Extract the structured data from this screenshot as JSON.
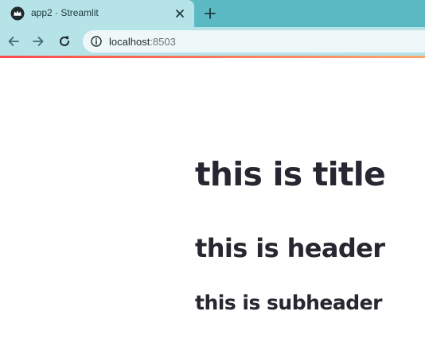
{
  "browser": {
    "tab": {
      "title": "app2 · Streamlit",
      "favicon": "streamlit-crown-icon"
    },
    "address_bar": {
      "host": "localhost",
      "port": ":8503"
    },
    "icons": {
      "back": "arrow-left-icon",
      "forward": "arrow-right-icon",
      "reload": "reload-icon",
      "info": "info-icon",
      "close_tab": "close-icon",
      "new_tab": "plus-icon"
    },
    "colors": {
      "tabstrip": "#5bb9c4",
      "toolbar": "#b6e3e8",
      "omnibox": "#eef8f9"
    }
  },
  "app": {
    "title": "this is title",
    "header": "this is header",
    "subheader": "this is subheader",
    "colors": {
      "text": "#262730",
      "decoration_start": "#ff4b4b",
      "decoration_end": "#fda66a"
    }
  }
}
